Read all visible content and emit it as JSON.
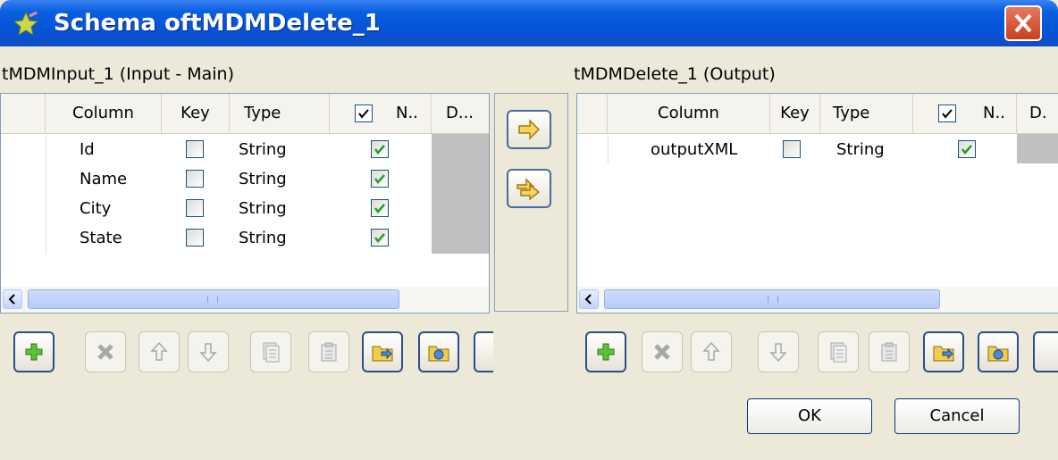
{
  "window": {
    "title": "Schema oftMDMDelete_1"
  },
  "input_panel": {
    "label": "tMDMInput_1 (Input - Main)",
    "headers": {
      "column": "Column",
      "key": "Key",
      "type": "Type",
      "nullable": "N..",
      "default": "D..."
    },
    "rows": [
      {
        "column": "Id",
        "key": false,
        "type": "String",
        "nullable": true
      },
      {
        "column": "Name",
        "key": false,
        "type": "String",
        "nullable": true
      },
      {
        "column": "City",
        "key": false,
        "type": "String",
        "nullable": true
      },
      {
        "column": "State",
        "key": false,
        "type": "String",
        "nullable": true
      }
    ]
  },
  "output_panel": {
    "label": "tMDMDelete_1 (Output)",
    "headers": {
      "column": "Column",
      "key": "Key",
      "type": "Type",
      "nullable": "N..",
      "default": "D."
    },
    "rows": [
      {
        "column": "outputXML",
        "key": false,
        "type": "String",
        "nullable": true
      }
    ]
  },
  "toolbar_icons": [
    "add-icon",
    "remove-icon",
    "move-up-icon",
    "move-down-icon",
    "copy-icon",
    "paste-icon",
    "import-icon",
    "export-icon"
  ],
  "middle_buttons": [
    "copy-selected-icon",
    "copy-all-icon"
  ],
  "buttons": {
    "ok": "OK",
    "cancel": "Cancel"
  },
  "colors": {
    "titlebar": "#0654d8",
    "dialog_bg": "#ece9d8",
    "close": "#d9532e"
  }
}
